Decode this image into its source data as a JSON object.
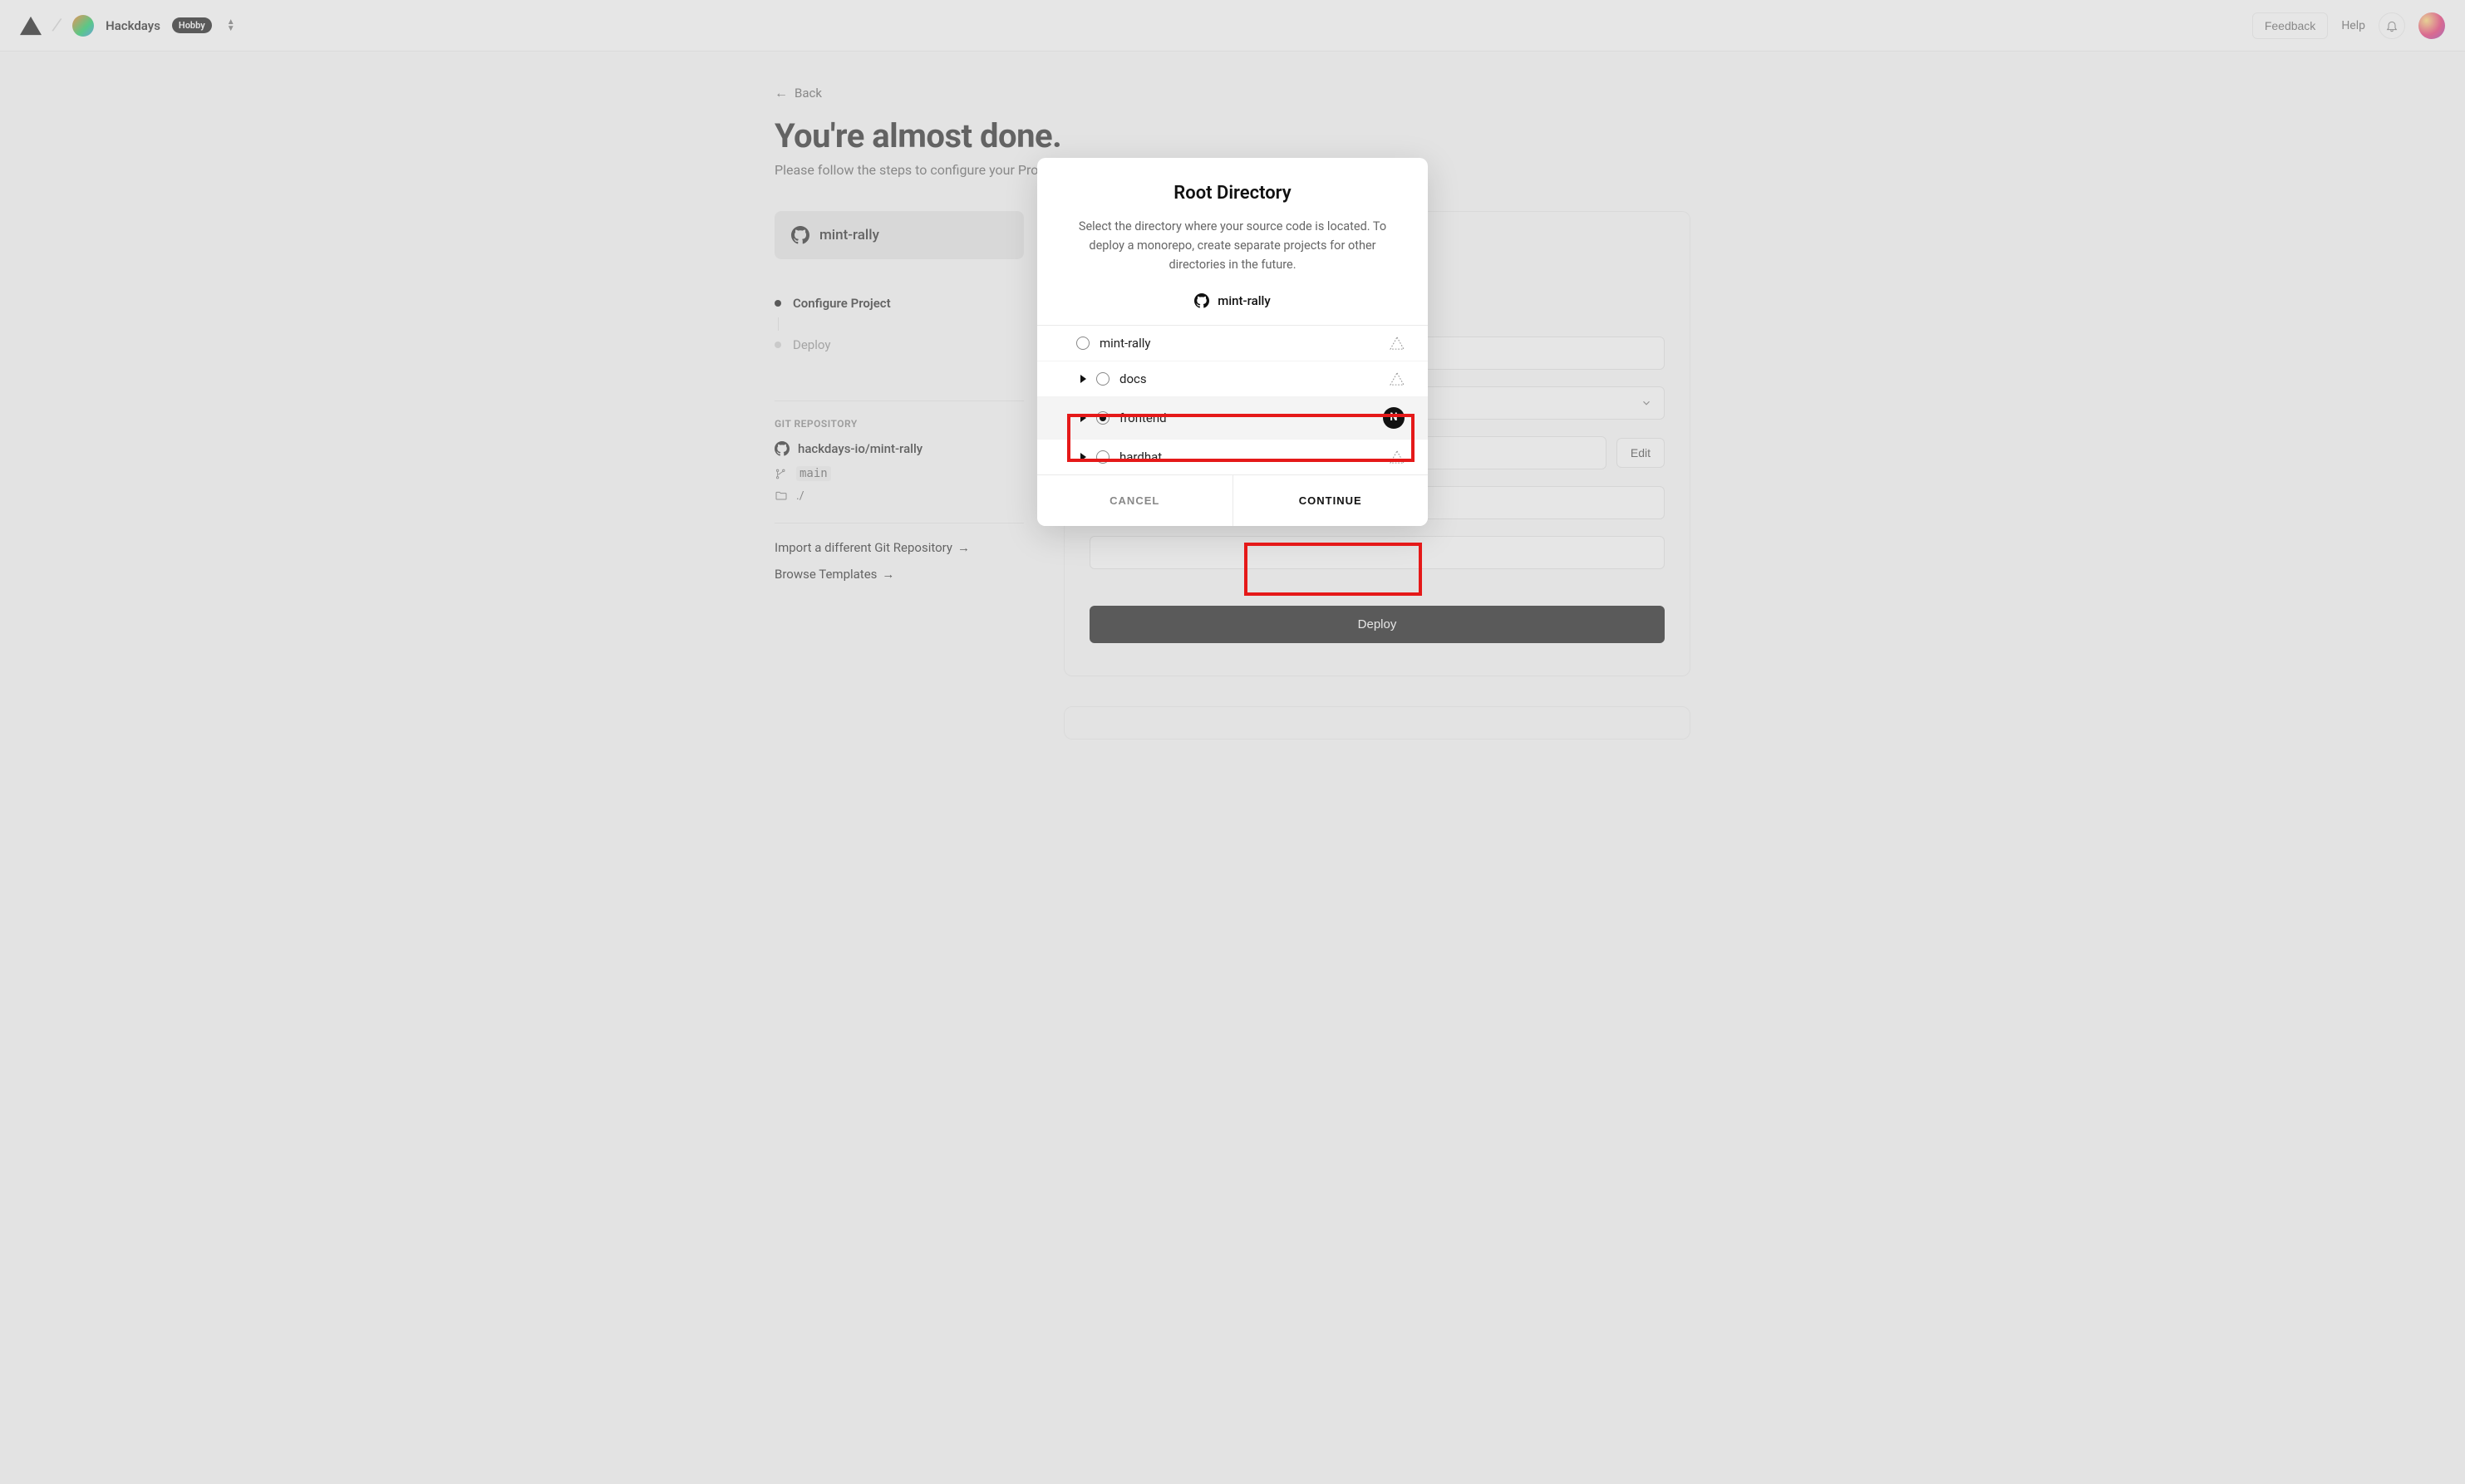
{
  "header": {
    "team_name": "Hackdays",
    "plan_badge": "Hobby",
    "feedback": "Feedback",
    "help": "Help"
  },
  "page": {
    "back_label": "Back",
    "title": "You're almost done.",
    "subtitle": "Please follow the steps to configure your Project and deploy it."
  },
  "sidebar": {
    "repo_card_name": "mint-rally",
    "steps": {
      "configure": "Configure Project",
      "deploy": "Deploy"
    },
    "git_heading": "GIT REPOSITORY",
    "repo_full": "hackdays-io/mint-rally",
    "branch": "main",
    "root_path": "./",
    "import_link": "Import a different Git Repository",
    "browse_link": "Browse Templates"
  },
  "main": {
    "edit_label": "Edit",
    "deploy_label": "Deploy"
  },
  "modal": {
    "title": "Root Directory",
    "description": "Select the directory where your source code is located. To deploy a monorepo, create separate projects for other directories in the future.",
    "repo_name": "mint-rally",
    "directories": [
      {
        "name": "mint-rally",
        "depth": 0,
        "expandable": false,
        "selected": false,
        "framework": "none"
      },
      {
        "name": "docs",
        "depth": 1,
        "expandable": true,
        "selected": false,
        "framework": "none"
      },
      {
        "name": "frontend",
        "depth": 1,
        "expandable": true,
        "selected": true,
        "framework": "nextjs"
      },
      {
        "name": "hardhat",
        "depth": 1,
        "expandable": true,
        "selected": false,
        "framework": "none"
      }
    ],
    "cancel": "CANCEL",
    "continue": "CONTINUE"
  }
}
